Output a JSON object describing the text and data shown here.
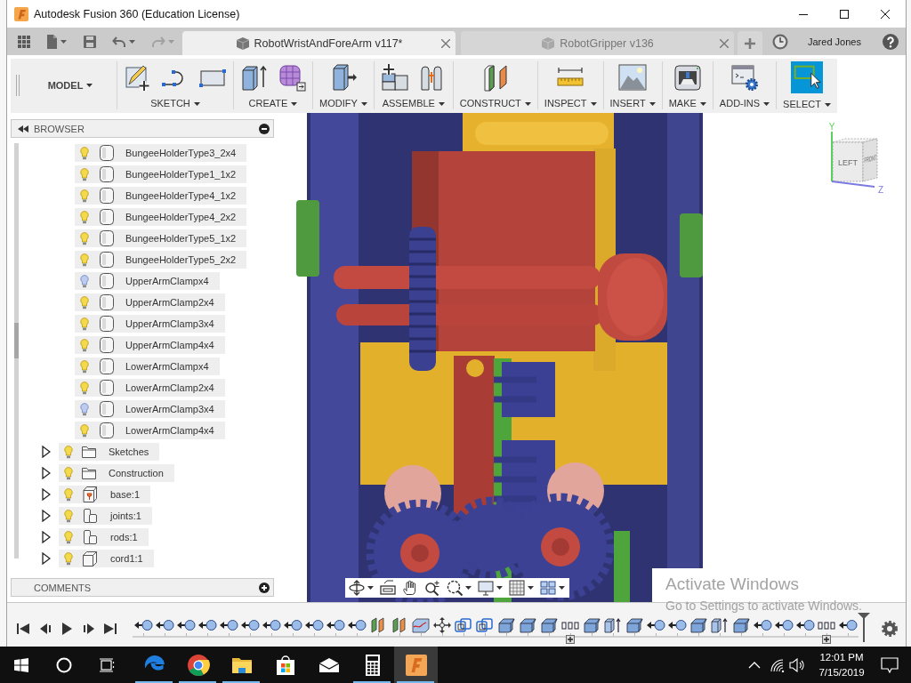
{
  "window": {
    "title": "Autodesk Fusion 360 (Education License)"
  },
  "quick_access": {
    "redo_enabled": false
  },
  "tabs": [
    {
      "title": "RobotWristAndForeArm v117*",
      "selected": true
    },
    {
      "title": "RobotGripper v136",
      "selected": false
    }
  ],
  "user": {
    "name": "Jared Jones"
  },
  "toolbar": {
    "workspace": "MODEL",
    "groups": [
      {
        "label": "SKETCH",
        "kind": "sketch",
        "active": false
      },
      {
        "label": "CREATE",
        "kind": "create",
        "active": false
      },
      {
        "label": "MODIFY",
        "kind": "modify",
        "active": false
      },
      {
        "label": "ASSEMBLE",
        "kind": "assemble",
        "active": false
      },
      {
        "label": "CONSTRUCT",
        "kind": "construct",
        "active": false
      },
      {
        "label": "INSPECT",
        "kind": "inspect",
        "active": false
      },
      {
        "label": "INSERT",
        "kind": "insert",
        "active": false
      },
      {
        "label": "MAKE",
        "kind": "make",
        "active": false
      },
      {
        "label": "ADD-INS",
        "kind": "addins",
        "active": false
      },
      {
        "label": "SELECT",
        "kind": "select",
        "active": true
      }
    ]
  },
  "browser": {
    "title": "BROWSER",
    "continued_children": [
      {
        "name": "BungeeHolderType3_2x4",
        "kind": "body",
        "visible": true
      },
      {
        "name": "BungeeHolderType1_1x2",
        "kind": "body",
        "visible": true
      },
      {
        "name": "BungeeHolderType4_1x2",
        "kind": "body",
        "visible": true
      },
      {
        "name": "BungeeHolderType4_2x2",
        "kind": "body",
        "visible": true
      },
      {
        "name": "BungeeHolderType5_1x2",
        "kind": "body",
        "visible": true
      },
      {
        "name": "BungeeHolderType5_2x2",
        "kind": "body",
        "visible": true
      },
      {
        "name": "UpperArmClampx4",
        "kind": "body",
        "visible": false
      },
      {
        "name": "UpperArmClamp2x4",
        "kind": "body",
        "visible": true
      },
      {
        "name": "UpperArmClamp3x4",
        "kind": "body",
        "visible": true
      },
      {
        "name": "UpperArmClamp4x4",
        "kind": "body",
        "visible": true
      },
      {
        "name": "LowerArmClampx4",
        "kind": "body",
        "visible": true
      },
      {
        "name": "LowerArmClamp2x4",
        "kind": "body",
        "visible": true
      },
      {
        "name": "LowerArmClamp3x4",
        "kind": "body",
        "visible": false
      },
      {
        "name": "LowerArmClamp4x4",
        "kind": "body",
        "visible": true
      }
    ],
    "items": [
      {
        "name": "Sketches",
        "kind": "folder",
        "visible": true,
        "expanded": false
      },
      {
        "name": "Construction",
        "kind": "folder",
        "visible": true,
        "expanded": false
      },
      {
        "name": "base:1",
        "kind": "pinned-component",
        "visible": true,
        "expanded": false
      },
      {
        "name": "joints:1",
        "kind": "component",
        "visible": true,
        "expanded": false
      },
      {
        "name": "rods:1",
        "kind": "component",
        "visible": true,
        "expanded": false
      },
      {
        "name": "cord1:1",
        "kind": "part",
        "visible": true,
        "expanded": false
      }
    ]
  },
  "comments": {
    "title": "COMMENTS"
  },
  "viewcube": {
    "faces": [
      "LEFT",
      "FRONT"
    ],
    "axes": [
      "Y",
      "Z"
    ]
  },
  "timeline": {
    "features": [
      {
        "kind": "joint",
        "group_marker": false
      },
      {
        "kind": "joint",
        "group_marker": false
      },
      {
        "kind": "joint",
        "group_marker": false
      },
      {
        "kind": "joint",
        "group_marker": false
      },
      {
        "kind": "joint",
        "group_marker": false
      },
      {
        "kind": "joint",
        "group_marker": false
      },
      {
        "kind": "joint",
        "group_marker": false
      },
      {
        "kind": "joint",
        "group_marker": false
      },
      {
        "kind": "joint",
        "group_marker": false
      },
      {
        "kind": "joint",
        "group_marker": false
      },
      {
        "kind": "joint",
        "group_marker": false
      },
      {
        "kind": "plane",
        "group_marker": false
      },
      {
        "kind": "plane",
        "group_marker": false
      },
      {
        "kind": "sketch",
        "group_marker": false
      },
      {
        "kind": "move",
        "group_marker": false
      },
      {
        "kind": "copy",
        "group_marker": false
      },
      {
        "kind": "copy",
        "group_marker": false
      },
      {
        "kind": "component",
        "group_marker": false
      },
      {
        "kind": "component",
        "group_marker": false
      },
      {
        "kind": "component",
        "group_marker": false
      },
      {
        "kind": "pattern",
        "group_marker": true
      },
      {
        "kind": "component",
        "group_marker": false
      },
      {
        "kind": "extrude",
        "group_marker": false
      },
      {
        "kind": "component",
        "group_marker": false
      },
      {
        "kind": "joint",
        "group_marker": false
      },
      {
        "kind": "joint",
        "group_marker": false
      },
      {
        "kind": "component",
        "group_marker": false
      },
      {
        "kind": "extrude",
        "group_marker": false
      },
      {
        "kind": "component",
        "group_marker": false
      },
      {
        "kind": "joint",
        "group_marker": false
      },
      {
        "kind": "joint",
        "group_marker": false
      },
      {
        "kind": "joint",
        "group_marker": false
      },
      {
        "kind": "pattern",
        "group_marker": true
      },
      {
        "kind": "joint",
        "group_marker": false
      }
    ]
  },
  "activation_notice": {
    "title": "Activate Windows",
    "message": "Go to Settings to activate Windows."
  },
  "taskbar": {
    "apps": [
      {
        "kind": "browser-e",
        "running": true,
        "active": false
      },
      {
        "kind": "browser-ring",
        "running": true,
        "active": false
      },
      {
        "kind": "files",
        "running": true,
        "active": false
      },
      {
        "kind": "store",
        "running": false,
        "active": false
      },
      {
        "kind": "mail",
        "running": false,
        "active": false
      },
      {
        "kind": "calculator",
        "running": true,
        "active": false
      },
      {
        "kind": "cad",
        "running": true,
        "active": true
      }
    ],
    "clock": {
      "time": "12:01 PM",
      "date": "7/15/2019"
    }
  }
}
